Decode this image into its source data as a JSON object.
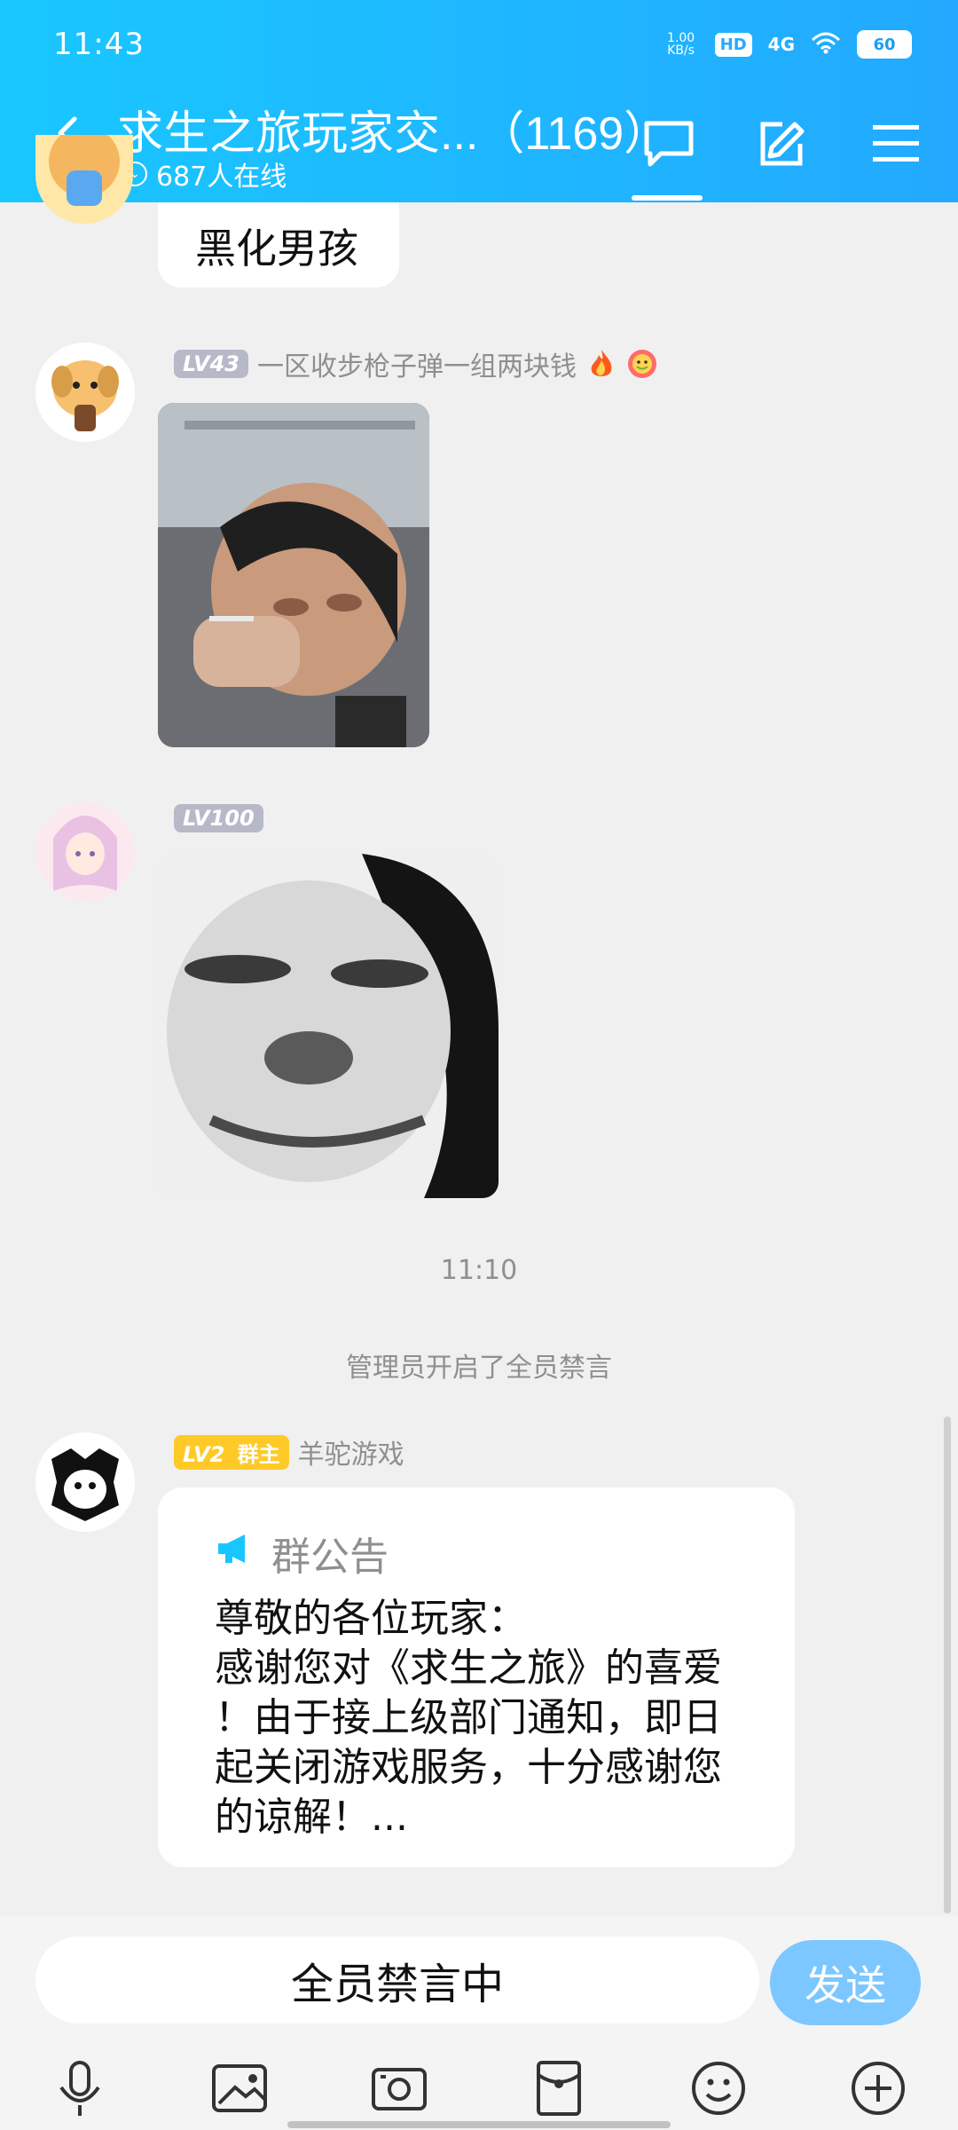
{
  "status_bar": {
    "time": "11:43",
    "net_speed": "1.00 KB/s",
    "hd": "HD",
    "signal": "4G",
    "battery": "60"
  },
  "header": {
    "title": "求生之旅玩家交...（1169）",
    "online_text": "687人在线"
  },
  "messages": [
    {
      "text": "黑化男孩"
    },
    {
      "lv": "LV43",
      "nickname": "一区收步枪子弹一组两块钱",
      "emojis": [
        "fire",
        "smile"
      ]
    },
    {
      "lv": "LV100"
    }
  ],
  "timestamp": "11:10",
  "system_notice": "管理员开启了全员禁言",
  "announcement": {
    "lv": "LV2",
    "role": "群主",
    "nickname": "羊驼游戏",
    "title": "群公告",
    "body": "尊敬的各位玩家：\n感谢您对《求生之旅》的喜爱\n！由于接上级部门通知，即日\n起关闭游戏服务，十分感谢您\n的谅解！..."
  },
  "input": {
    "placeholder_text": "全员禁言中",
    "send_label": "发送"
  },
  "colors": {
    "header_start": "#19c7ff",
    "header_end": "#23a9ff",
    "send_button": "#7cc7ff",
    "lv_gold": "#ffca28"
  }
}
